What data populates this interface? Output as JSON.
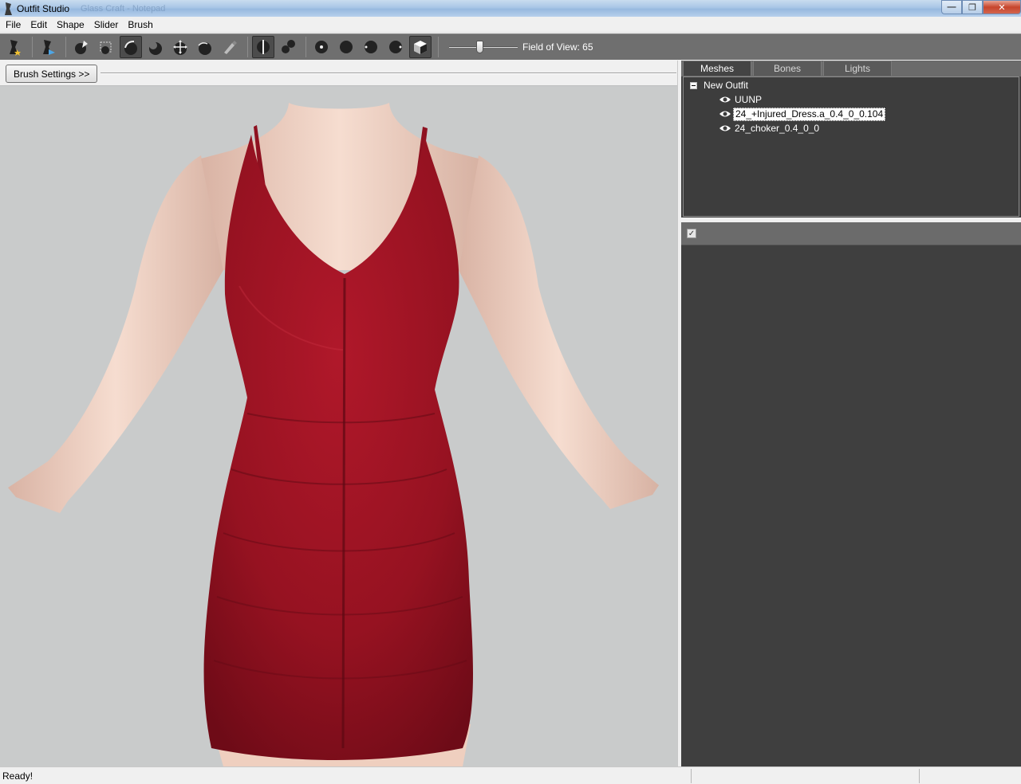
{
  "window": {
    "title": "Outfit Studio",
    "background_text": "Glass Craft - Notepad"
  },
  "menu": [
    "File",
    "Edit",
    "Shape",
    "Slider",
    "Brush"
  ],
  "toolbar": {
    "tools": [
      "load-outfit-icon",
      "load-reference-icon",
      "select-tool-icon",
      "mask-tool-icon",
      "inflate-brush-icon",
      "deflate-brush-icon",
      "move-brush-icon",
      "smooth-brush-icon",
      "weight-brush-icon",
      "mirror-x-icon",
      "connected-only-icon",
      "view-front-icon",
      "view-back-icon",
      "view-left-icon",
      "view-right-icon",
      "perspective-icon"
    ],
    "fov_label": "Field of View: 65",
    "fov_value": 65
  },
  "brush": {
    "settings_label": "Brush Settings >>"
  },
  "tabs": [
    {
      "label": "Meshes",
      "active": true
    },
    {
      "label": "Bones",
      "active": false
    },
    {
      "label": "Lights",
      "active": false
    }
  ],
  "tree": {
    "root": "New Outfit",
    "items": [
      {
        "label": "UUNP",
        "selected": false
      },
      {
        "label": "24_+Injured_Dress.a_0.4_0_0.104",
        "selected": true
      },
      {
        "label": "24_choker_0.4_0_0",
        "selected": false
      }
    ]
  },
  "sliders": {
    "check_glyph": "✓"
  },
  "status": {
    "text": "Ready!"
  },
  "colors": {
    "dress": "#9a1424",
    "skin": "#f3d6c6",
    "viewport_bg": "#c9cbcb",
    "panel_dark": "#3f3f3f"
  }
}
